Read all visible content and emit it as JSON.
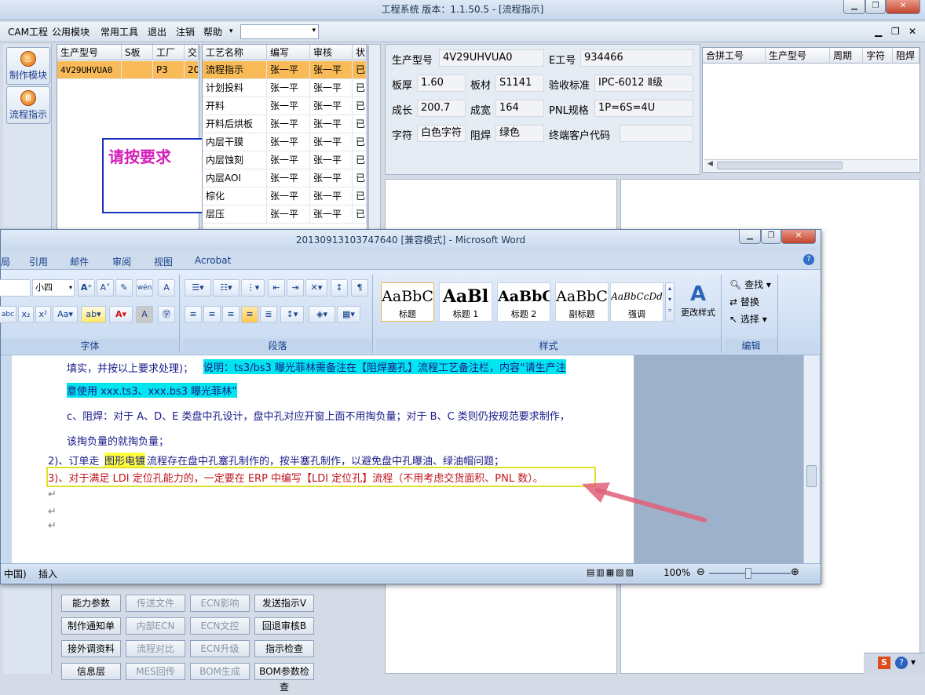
{
  "app": {
    "title": "工程系统   版本：1.1.50.5 - [流程指示]",
    "menu": [
      "CAM工程",
      "公用模块",
      "常用工具",
      "退出",
      "注销",
      "帮助"
    ],
    "menu_more": "▾"
  },
  "nav": [
    {
      "label": "制作模块"
    },
    {
      "label": "流程指示"
    }
  ],
  "orders": {
    "columns": [
      "生产型号",
      "S板",
      "工厂",
      "交"
    ],
    "rows": [
      [
        "4V29UHVUA0",
        "",
        "P3",
        "20"
      ]
    ]
  },
  "process": {
    "columns": [
      "工艺名称",
      "编写",
      "审核",
      "状"
    ],
    "rows": [
      [
        "流程指示",
        "张一平",
        "张一平",
        "已"
      ],
      [
        "计划投料",
        "张一平",
        "张一平",
        "已"
      ],
      [
        "开料",
        "张一平",
        "张一平",
        "已"
      ],
      [
        "开料后烘板",
        "张一平",
        "张一平",
        "已"
      ],
      [
        "内层干膜",
        "张一平",
        "张一平",
        "已"
      ],
      [
        "内层蚀刻",
        "张一平",
        "张一平",
        "已"
      ],
      [
        "内层AOI",
        "张一平",
        "张一平",
        "已"
      ],
      [
        "棕化",
        "张一平",
        "张一平",
        "已"
      ],
      [
        "层压",
        "张一平",
        "张一平",
        "已"
      ]
    ]
  },
  "popup": {
    "text": "请按要求"
  },
  "info": {
    "model_label": "生产型号",
    "model": "4V29UHVUA0",
    "e_label": "E工号",
    "e_no": "934466",
    "thk_label": "板厚",
    "thk": "1.60",
    "mat_label": "板材",
    "mat": "S1141",
    "std_label": "验收标准",
    "std": "IPC-6012 Ⅱ级",
    "len_label": "成长",
    "len": "200.7",
    "wid_label": "成宽",
    "wid": "164",
    "pnl_label": "PNL规格",
    "pnl": "1P=6S=4U",
    "char_label": "字符",
    "char": "白色字符",
    "sm_label": "阻焊",
    "sm": "绿色",
    "cust_label": "终端客户代码",
    "cust": ""
  },
  "combine": {
    "columns": [
      "合拼工号",
      "生产型号",
      "周期",
      "字符",
      "阻焊"
    ]
  },
  "word": {
    "title": "20130913103747640 [兼容模式] - Microsoft Word",
    "tabs": [
      "引用",
      "邮件",
      "审阅",
      "视图",
      "Acrobat"
    ],
    "font_size": "小四",
    "groups": {
      "font": "字体",
      "para": "段落",
      "styles": "样式",
      "edit": "编辑"
    },
    "styles": [
      {
        "preview": "AaBbC",
        "name": "标题"
      },
      {
        "preview": "AaBl",
        "name": "标题 1"
      },
      {
        "preview": "AaBbC",
        "name": "标题 2"
      },
      {
        "preview": "AaBbC",
        "name": "副标题"
      },
      {
        "preview": "AaBbCcDd",
        "name": "强调"
      }
    ],
    "change_style": "更改样式",
    "edit": {
      "find": "查找",
      "replace": "替换",
      "select": "选择"
    },
    "doc_lines": [
      "填实，并按以上要求处理)；",
      "说明：ts3/bs3 曝光菲林需备注在【阻焊塞孔】流程工艺备注栏，内容“请生产注",
      "意使用 xxx.ts3、xxx.bs3 曝光菲林”",
      "c、阻焊：对于 A、D、E 类盘中孔设计，盘中孔对应开窗上面不用掏负量；对于 B、C 类则仍按规范要求制作，",
      "该掏负量的就掏负量；",
      "2)、订单走",
      "图形电镀",
      "流程存在盘中孔塞孔制作的，按半塞孔制作，以避免盘中孔曝油、绿油帽问题；",
      "3)、对于满足 LDI 定位孔能力的，一定要在 ERP 中编写【LDI 定位孔】流程（不用考虑交货面积、PNL 数）。"
    ],
    "status": {
      "lang": "中国)",
      "mode": "插入",
      "zoom": "100%"
    }
  },
  "bottom_buttons": [
    [
      "能力参数",
      "传送文件",
      "ECN影响",
      "发送指示V"
    ],
    [
      "制作通知单",
      "内部ECN",
      "ECN文控",
      "回退审核B"
    ],
    [
      "接外调资料",
      "流程对比",
      "ECN升级",
      "指示检查"
    ],
    [
      "信息层",
      "MES回传",
      "BOM生成",
      "BOM参数检查"
    ]
  ],
  "colors": {
    "selected_row": "#f9bb58",
    "popup_text": "#d41fb9",
    "highlight_cyan": "#00e5ee",
    "highlight_yellow": "#ffff3a",
    "doc_red": "#c0151b",
    "arrow": "#e0607a"
  }
}
